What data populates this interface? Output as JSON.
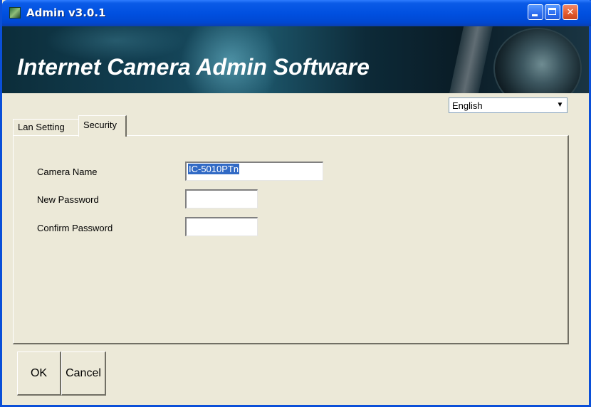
{
  "window": {
    "title": "Admin v3.0.1"
  },
  "banner": {
    "title": "Internet Camera Admin Software"
  },
  "language": {
    "selected": "English"
  },
  "tabs": [
    {
      "label": "Lan Setting",
      "active": false
    },
    {
      "label": "Security",
      "active": true
    }
  ],
  "security": {
    "camera_name_label": "Camera Name",
    "camera_name_value": "IC-5010PTn",
    "new_password_label": "New Password",
    "new_password_value": "",
    "confirm_password_label": "Confirm Password",
    "confirm_password_value": ""
  },
  "buttons": {
    "ok": "OK",
    "cancel": "Cancel"
  },
  "colors": {
    "titlebar": "#0050e0",
    "window_bg": "#ece9d8",
    "selection": "#316ac5"
  }
}
